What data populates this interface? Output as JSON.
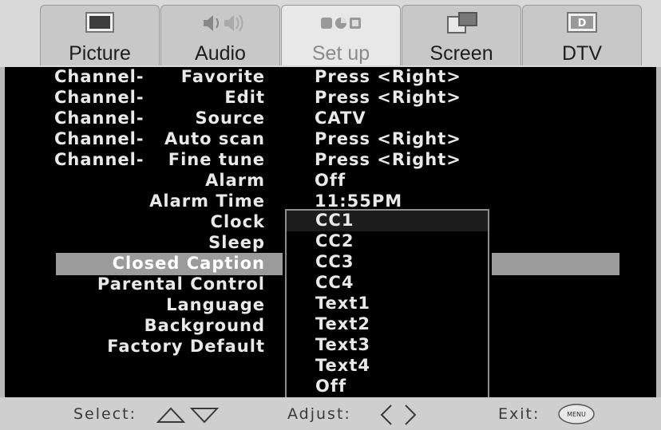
{
  "tabs": [
    {
      "label": "Picture",
      "icon": "tv-icon"
    },
    {
      "label": "Audio",
      "icon": "speaker-icon"
    },
    {
      "label": "Set up",
      "icon": "setup-icon",
      "active": true
    },
    {
      "label": "Screen",
      "icon": "screen-icon"
    },
    {
      "label": "DTV",
      "icon": "dtv-icon",
      "badge": "D"
    }
  ],
  "menu": {
    "rows": [
      {
        "prefix": "Channel-",
        "item": "Favorite",
        "value": "Press <Right>"
      },
      {
        "prefix": "Channel-",
        "item": "Edit",
        "value": "Press <Right>"
      },
      {
        "prefix": "Channel-",
        "item": "Source",
        "value": "CATV"
      },
      {
        "prefix": "Channel-",
        "item": "Auto scan",
        "value": "Press <Right>"
      },
      {
        "prefix": "Channel-",
        "item": "Fine tune",
        "value": "Press <Right>"
      },
      {
        "prefix": "",
        "item": "Alarm",
        "value": "Off"
      },
      {
        "prefix": "",
        "item": "Alarm Time",
        "value": "11:55PM"
      },
      {
        "prefix": "",
        "item": "Clock",
        "value": ""
      },
      {
        "prefix": "",
        "item": "Sleep",
        "value": ""
      },
      {
        "prefix": "",
        "item": "Closed Caption",
        "value": ""
      },
      {
        "prefix": "",
        "item": "Parental Control",
        "value": ""
      },
      {
        "prefix": "",
        "item": "Language",
        "value": ""
      },
      {
        "prefix": "",
        "item": "Background",
        "value": ""
      },
      {
        "prefix": "",
        "item": "Factory Default",
        "value": ""
      }
    ],
    "selected_item": "Closed Caption"
  },
  "dropdown": {
    "options": [
      "CC1",
      "CC2",
      "CC3",
      "CC4",
      "Text1",
      "Text2",
      "Text3",
      "Text4",
      "Off"
    ],
    "current": "CC1"
  },
  "footer": {
    "select_label": "Select:",
    "adjust_label": "Adjust:",
    "exit_label": "Exit:",
    "menu_button": "MENU"
  }
}
